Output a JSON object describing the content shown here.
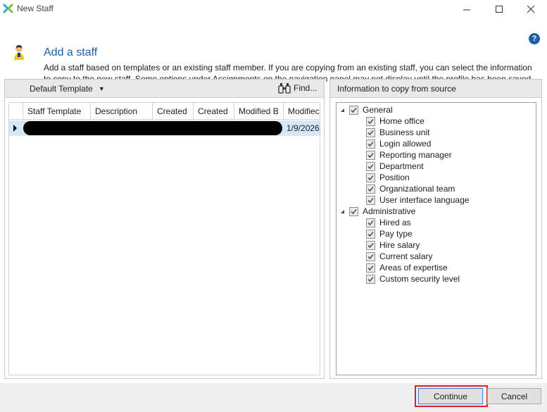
{
  "window": {
    "title": "New Staff",
    "min_icon": "minimize-icon",
    "max_icon": "maximize-icon",
    "close_icon": "close-icon"
  },
  "header": {
    "title": "Add a staff",
    "description": "Add a staff based on templates or an existing staff member. If you are copying from an existing staff, you can select the information to copy to the new staff. Some options under Assignments on the navigation panel may not display until the profile has been saved.",
    "help_label": "?"
  },
  "left_panel": {
    "template_select": "Default Template",
    "find_label": "Find...",
    "columns": [
      "Staff Template",
      "Description",
      "Created",
      "Created",
      "Modified B",
      "Modifiec"
    ],
    "rows": [
      {
        "modified": "1/9/2026"
      }
    ]
  },
  "right_panel": {
    "title": "Information to copy from source",
    "groups": [
      {
        "label": "General",
        "items": [
          "Home office",
          "Business unit",
          "Login allowed",
          "Reporting manager",
          "Department",
          "Position",
          "Organizational team",
          "User interface language"
        ]
      },
      {
        "label": "Administrative",
        "items": [
          "Hired as",
          "Pay type",
          "Hire salary",
          "Current salary",
          "Areas of expertise",
          "Custom security level"
        ]
      }
    ]
  },
  "footer": {
    "continue_label": "Continue",
    "cancel_label": "Cancel"
  },
  "colors": {
    "accent": "#1f5fa8",
    "selected_row": "#d6e8f7",
    "highlight": "#e02020"
  }
}
